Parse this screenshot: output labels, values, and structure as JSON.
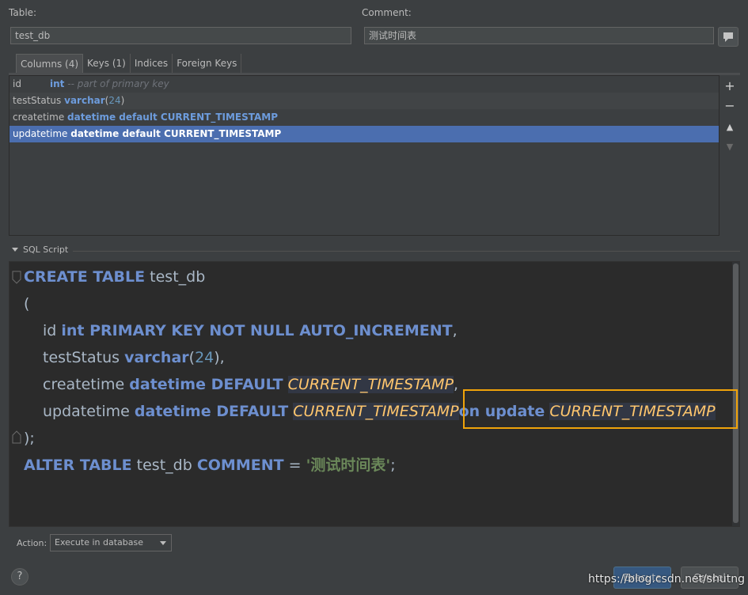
{
  "table_label": "Table:",
  "table_value": "test_db",
  "comment_label": "Comment:",
  "comment_value": "测试时间表",
  "tabs": [
    "Columns (4)",
    "Keys (1)",
    "Indices",
    "Foreign Keys"
  ],
  "columns": [
    {
      "name": "id",
      "type": "int",
      "hint": "-- part of primary key"
    },
    {
      "name": "testStatus",
      "type": "varchar",
      "lparen": "(",
      "num": "24",
      "rparen": ")"
    },
    {
      "name": "createtime",
      "type": "datetime default CURRENT_TIMESTAMP"
    },
    {
      "name": "updatetime",
      "type": "datetime default CURRENT_TIMESTAMP"
    }
  ],
  "side_buttons": [
    "+",
    "−",
    "▲",
    "▼"
  ],
  "sql_section_label": "SQL Script",
  "sql": {
    "create_kw": "CREATE TABLE",
    "table_name": "test_db",
    "open_paren": "(",
    "id_name": "id",
    "id_def": "int PRIMARY KEY NOT NULL AUTO_INCREMENT",
    "comma": ",",
    "ts_name": "testStatus",
    "ts_type": "varchar",
    "ts_lp": "(",
    "ts_num": "24",
    "ts_rp": "),",
    "ct_name": "createtime",
    "ct_def": "datetime DEFAULT",
    "ct_fn": "CURRENT_TIMESTAMP",
    "ut_name": "updatetime",
    "ut_def": "datetime DEFAULT",
    "ut_fn": "CURRENT_TIMESTAMP",
    "ut_on": "on update",
    "ut_fn2": "CURRENT_TIMESTAMP",
    "close": ");",
    "alter_kw": "ALTER TABLE",
    "alter_table": "test_db",
    "comment_kw": "COMMENT",
    "eq": "=",
    "comment_str": "'测试时间表'",
    "semi": ";"
  },
  "action_label": "Action:",
  "action_value": "Execute in database",
  "help": "?",
  "execute_label": "Execute",
  "cancel_label": "Cancel",
  "watermark": "https://blog.csdn.net/shutng",
  "highlight_color": "#f0a30a"
}
